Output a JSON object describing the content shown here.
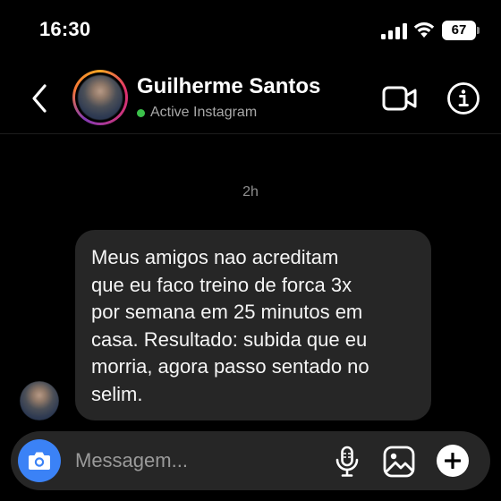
{
  "status_bar": {
    "time": "16:30",
    "battery_level": "67",
    "icons": [
      "signal-icon",
      "wifi-icon",
      "battery-icon"
    ]
  },
  "header": {
    "contact_name": "Guilherme Santos",
    "presence": "Active Instagram",
    "presence_color": "#3bc04a",
    "icons": [
      "back-arrow-icon",
      "video-camera-icon",
      "info-icon"
    ]
  },
  "conversation": {
    "timestamp": "2h",
    "messages": [
      {
        "direction": "incoming",
        "text": "Meus amigos nao acreditam\nque eu faco treino de forca 3x\npor semana em 25 minutos em\ncasa. Resultado: subida que eu\nmorria, agora passo sentado no\nselim."
      }
    ]
  },
  "composer": {
    "placeholder": "Messagem...",
    "camera_button_color": "#3b82f6",
    "icons": [
      "camera-icon",
      "microphone-icon",
      "image-icon",
      "plus-icon"
    ]
  }
}
